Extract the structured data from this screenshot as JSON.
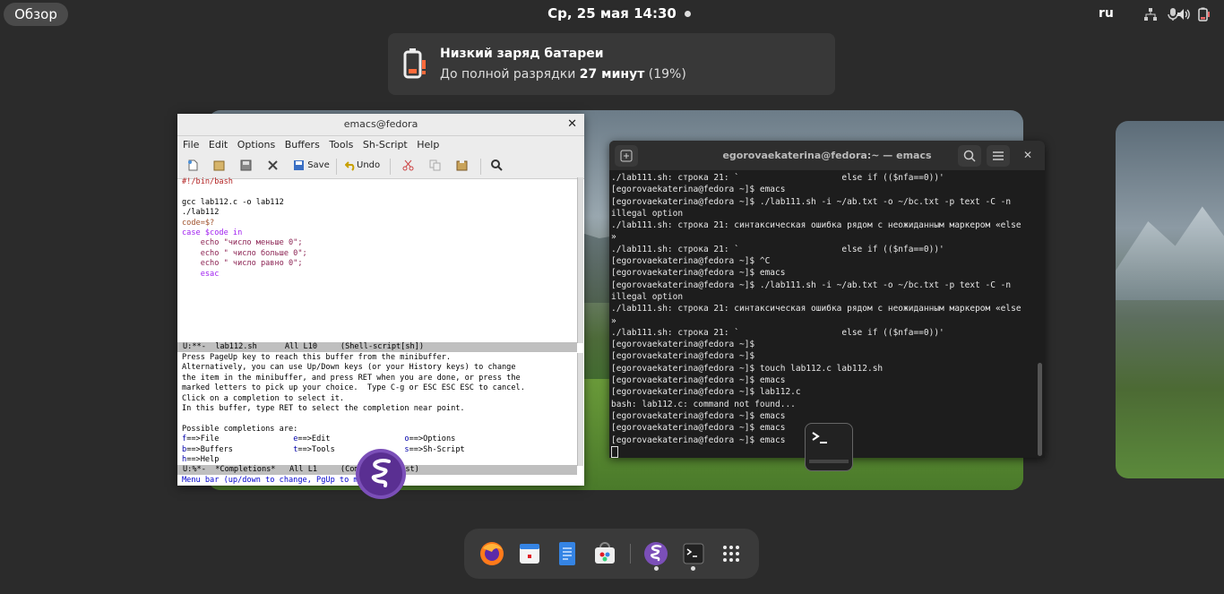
{
  "topbar": {
    "overview_label": "Обзор",
    "clock": "Ср, 25 мая  14:30",
    "language": "ru",
    "tray_icons": [
      "network-icon",
      "microphone-icon",
      "volume-icon",
      "battery-low-icon"
    ]
  },
  "notification": {
    "title": "Низкий заряд батареи",
    "body_prefix": "До полной разрядки ",
    "body_bold": "27 минут",
    "body_suffix": " (19%)",
    "icon": "battery-low-icon"
  },
  "emacs": {
    "title": "emacs@fedora",
    "menu": [
      "File",
      "Edit",
      "Options",
      "Buffers",
      "Tools",
      "Sh-Script",
      "Help"
    ],
    "toolbar": {
      "save": "Save",
      "undo": "Undo"
    },
    "code_lines": [
      "#!/bin/bash",
      "",
      "gcc lab112.c -o lab112",
      "./lab112",
      "code=$?",
      "case $code in",
      "    echo \"число меньше 0\";",
      "    echo \" число больше 0\";",
      "    echo \" число равно 0\";",
      "    esac"
    ],
    "modeline_top": "U:**-  lab112.sh      All L10     (Shell-script[sh])",
    "help_lines": [
      "Press PageUp key to reach this buffer from the minibuffer.",
      "Alternatively, you can use Up/Down keys (or your History keys) to change",
      "the item in the minibuffer, and press RET when you are done, or press the",
      "marked letters to pick up your choice.  Type C-g or ESC ESC ESC to cancel.",
      "Click on a completion to select it.",
      "In this buffer, type RET to select the completion near point.",
      "",
      "Possible completions are:"
    ],
    "completions": [
      {
        "k": "f",
        "v": "==>File"
      },
      {
        "k": "e",
        "v": "==>Edit"
      },
      {
        "k": "o",
        "v": "==>Options"
      },
      {
        "k": "b",
        "v": "==>Buffers"
      },
      {
        "k": "t",
        "v": "==>Tools"
      },
      {
        "k": "s",
        "v": "==>Sh-Script"
      },
      {
        "k": "h",
        "v": "==>Help"
      }
    ],
    "modeline_bottom": "U:%*-  *Completions*   All L1     (Completion List)",
    "minibuffer": "Menu bar (up/down to change, PgUp to menu): "
  },
  "terminal": {
    "title": "egorovaekaterina@fedora:~ — emacs",
    "lines": [
      "./lab111.sh: строка 21: `                    else if (($nfa==0))'",
      "[egorovaekaterina@fedora ~]$ emacs",
      "[egorovaekaterina@fedora ~]$ ./lab111.sh -i ~/ab.txt -o ~/bc.txt -p text -C -n",
      "illegal option",
      "./lab111.sh: строка 21: синтаксическая ошибка рядом с неожиданным маркером «else",
      "»",
      "./lab111.sh: строка 21: `                    else if (($nfa==0))'",
      "[egorovaekaterina@fedora ~]$ ^C",
      "[egorovaekaterina@fedora ~]$ emacs",
      "[egorovaekaterina@fedora ~]$ ./lab111.sh -i ~/ab.txt -o ~/bc.txt -p text -C -n",
      "illegal option",
      "./lab111.sh: строка 21: синтаксическая ошибка рядом с неожиданным маркером «else",
      "»",
      "./lab111.sh: строка 21: `                    else if (($nfa==0))'",
      "[egorovaekaterina@fedora ~]$",
      "[egorovaekaterina@fedora ~]$",
      "[egorovaekaterina@fedora ~]$ touch lab112.c lab112.sh",
      "[egorovaekaterina@fedora ~]$ emacs",
      "[egorovaekaterina@fedora ~]$ lab112.c",
      "bash: lab112.c: command not found...",
      "[egorovaekaterina@fedora ~]$ emacs",
      "[egorovaekaterina@fedora ~]$ emacs",
      "[egorovaekaterina@fedora ~]$ emacs"
    ]
  },
  "dock": {
    "items": [
      "firefox-icon",
      "calendar-icon",
      "text-editor-icon",
      "software-icon",
      "emacs-icon",
      "terminal-icon",
      "app-grid-icon"
    ]
  }
}
